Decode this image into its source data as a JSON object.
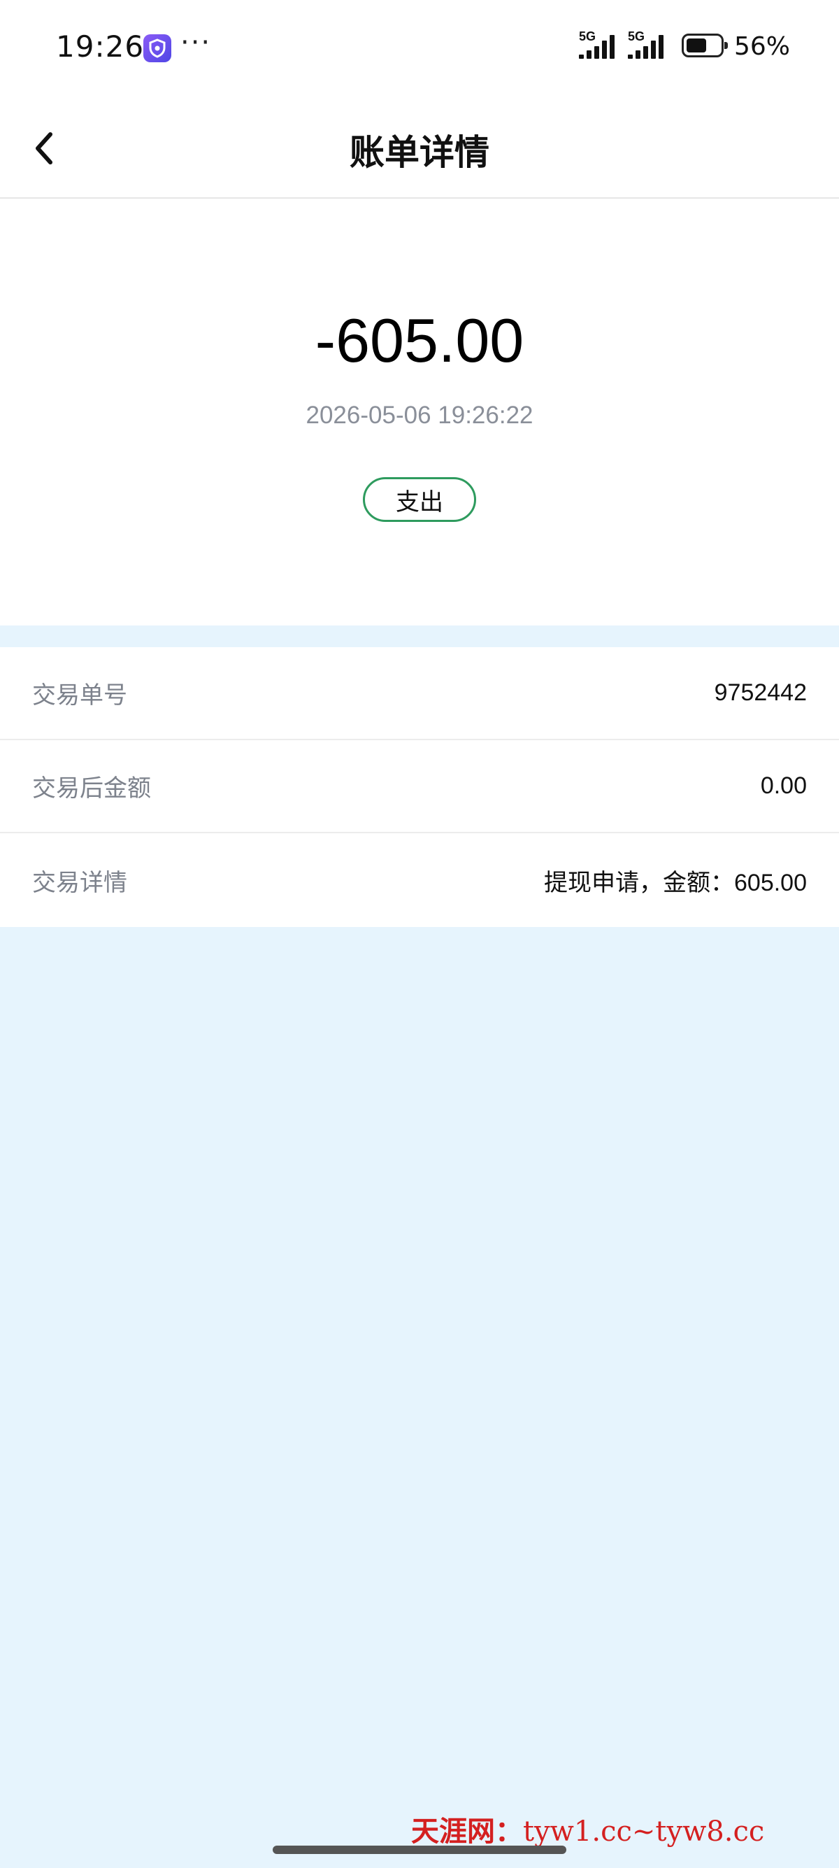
{
  "status_bar": {
    "time": "19:26",
    "signal1_label": "5G",
    "signal2_label": "5G",
    "battery_percent": "56%",
    "battery_level": 0.56,
    "icons": [
      "shield-app-icon",
      "more-dots-icon",
      "signal-icon",
      "battery-icon"
    ]
  },
  "header": {
    "title": "账单详情",
    "back_icon": "chevron-left-icon"
  },
  "summary": {
    "amount": "-605.00",
    "datetime": "2026-05-06 19:26:22",
    "type_badge": "支出",
    "badge_color": "#2e9b5e"
  },
  "details": {
    "rows": [
      {
        "label": "交易单号",
        "value": "9752442"
      },
      {
        "label": "交易后金额",
        "value": "0.00"
      },
      {
        "label": "交易详情",
        "value": "提现申请，金额：605.00"
      }
    ]
  },
  "watermark": {
    "brand": "天涯网：",
    "urls": "tyw1.cc~tyw8.cc",
    "color": "#d42020"
  },
  "colors": {
    "page_background": "#e6f4fd",
    "label_gray": "#7d828c"
  }
}
